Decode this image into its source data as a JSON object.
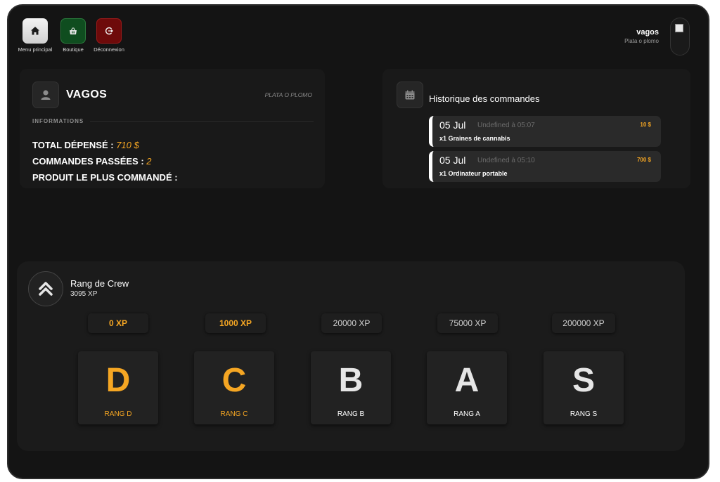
{
  "nav": [
    {
      "label": "Menu principal",
      "icon": "home-icon"
    },
    {
      "label": "Boutique",
      "icon": "basket-icon"
    },
    {
      "label": "Déconnexion",
      "icon": "logout-icon"
    }
  ],
  "user": {
    "name": "vagos",
    "subtitle": "Plata o plomo"
  },
  "gang": {
    "name": "VAGOS",
    "motto": "PLATA O PLOMO",
    "section_title": "INFORMATIONS",
    "stats": [
      {
        "label": "TOTAL DÉPENSÉ :",
        "value": "710 $"
      },
      {
        "label": "COMMANDES PASSÉES :",
        "value": "2"
      },
      {
        "label": "PRODUIT LE PLUS COMMANDÉ :",
        "value": ""
      }
    ]
  },
  "history": {
    "title": "Historique des commandes",
    "orders": [
      {
        "date": "05 Jul",
        "time": "Undefined à 05:07",
        "price": "10 $",
        "item": "x1 Graines de cannabis"
      },
      {
        "date": "05 Jul",
        "time": "Undefined à 05:10",
        "price": "700 $",
        "item": "x1 Ordinateur portable"
      }
    ]
  },
  "rank": {
    "title": "Rang de Crew",
    "xp": "3095 XP",
    "tiers": [
      {
        "xp": "0 XP",
        "letter": "D",
        "name": "RANG D",
        "unlocked": true
      },
      {
        "xp": "1000 XP",
        "letter": "C",
        "name": "RANG C",
        "unlocked": true
      },
      {
        "xp": "20000 XP",
        "letter": "B",
        "name": "RANG B",
        "unlocked": false
      },
      {
        "xp": "75000 XP",
        "letter": "A",
        "name": "RANG A",
        "unlocked": false
      },
      {
        "xp": "200000 XP",
        "letter": "S",
        "name": "RANG S",
        "unlocked": false
      }
    ]
  },
  "colors": {
    "accent": "#f5a623",
    "background": "#141414",
    "card": "#191919",
    "shop": "#0f4d1f",
    "logout": "#6e0a0a"
  }
}
